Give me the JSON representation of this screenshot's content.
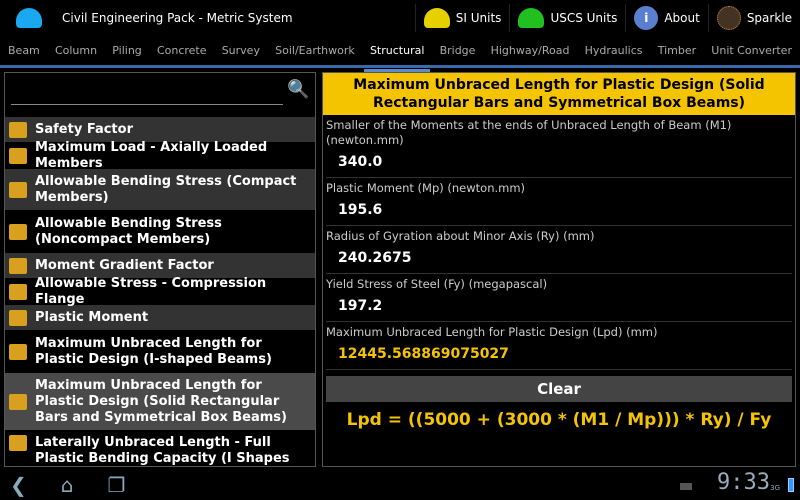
{
  "header": {
    "title": "Civil Engineering Pack - Metric System",
    "actions": [
      {
        "label": "SI Units",
        "color": "#e6d000"
      },
      {
        "label": "USCS Units",
        "color": "#20c020"
      },
      {
        "label": "About"
      },
      {
        "label": "Sparkle"
      }
    ]
  },
  "tabs": [
    "Beam",
    "Column",
    "Piling",
    "Concrete",
    "Survey",
    "Soil/Earthwork",
    "Structural",
    "Bridge",
    "Highway/Road",
    "Hydraulics",
    "Timber",
    "Unit Converter"
  ],
  "search": {
    "value": "",
    "placeholder": ""
  },
  "list": [
    "Safety Factor",
    "Maximum Load - Axially Loaded Members",
    "Allowable Bending Stress (Compact Members)",
    "Allowable Bending Stress (Noncompact Members)",
    "Moment Gradient Factor",
    "Allowable Stress - Compression Flange",
    "Plastic Moment",
    "Maximum Unbraced Length for Plastic Design (I-shaped Beams)",
    "Maximum Unbraced Length for Plastic Design (Solid Rectangular Bars and Symmetrical Box Beams)",
    "Laterally Unbraced Length - Full Plastic Bending Capacity (I Shapes and"
  ],
  "calc": {
    "title": "Maximum Unbraced Length for Plastic Design (Solid Rectangular Bars and Symmetrical Box Beams)",
    "fields": [
      {
        "label": "Smaller of the Moments at the ends of Unbraced Length of Beam (M1) (newton.mm)",
        "value": "340.0"
      },
      {
        "label": "Plastic Moment (Mp) (newton.mm)",
        "value": "195.6"
      },
      {
        "label": "Radius of Gyration about Minor Axis (Ry) (mm)",
        "value": "240.2675"
      },
      {
        "label": "Yield Stress of Steel (Fy) (megapascal)",
        "value": "197.2"
      }
    ],
    "result": {
      "label": "Maximum Unbraced Length for Plastic Design (Lpd) (mm)",
      "value": "12445.568869075027"
    },
    "clear": "Clear",
    "formula": "Lpd = ((5000 + (3000 * (M1 / Mp))) * Ry) / Fy"
  },
  "status": {
    "time": "9:33",
    "network": "3G"
  }
}
